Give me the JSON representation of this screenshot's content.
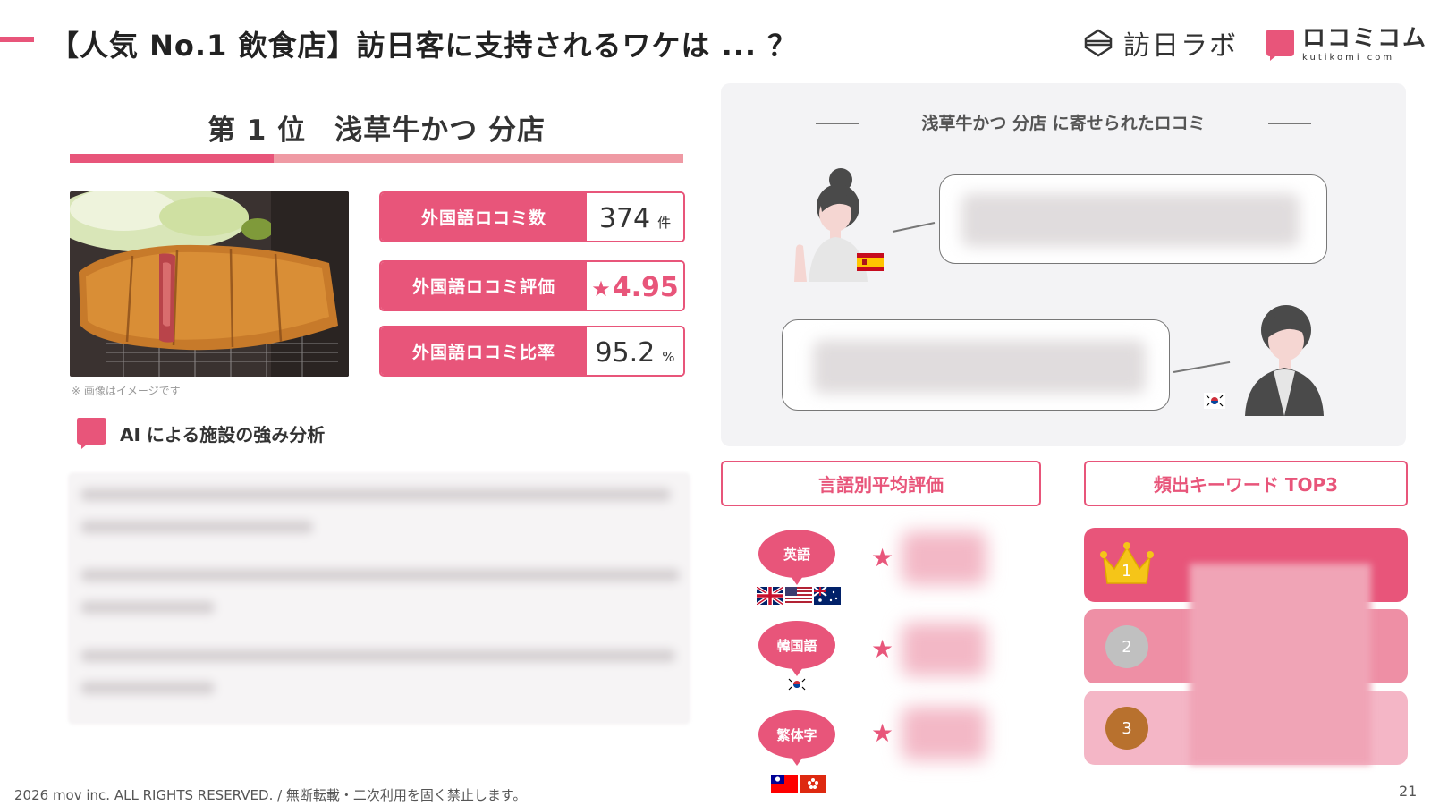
{
  "header": {
    "title": "【人気 No.1 飲食店】訪日客に支持されるワケは ... ？",
    "logo_houjin": "訪日ラボ",
    "logo_kuchikomi_main": "ロコミコム",
    "logo_kuchikomi_sub": "kutikomi com"
  },
  "ranking": {
    "title": "第 1 位　浅草牛かつ 分店",
    "photo_note": "※ 画像はイメージです"
  },
  "stats": [
    {
      "label": "外国語ロコミ数",
      "value": "374",
      "unit": "件"
    },
    {
      "label": "外国語ロコミ評価",
      "value": "4.95",
      "star": "★"
    },
    {
      "label": "外国語ロコミ比率",
      "value": "95.2",
      "unit": "%"
    }
  ],
  "ai_analysis": {
    "heading": "AI による施設の強み分析"
  },
  "reviews": {
    "title": "浅草牛かつ 分店 に寄せられたロコミ"
  },
  "language_ratings": {
    "heading": "言語別平均評価",
    "items": [
      {
        "label": "英語",
        "star": "★"
      },
      {
        "label": "韓国語",
        "star": "★"
      },
      {
        "label": "繁体字",
        "star": "★"
      }
    ]
  },
  "keywords": {
    "heading": "頻出キーワード TOP3",
    "ranks": [
      "1",
      "2",
      "3"
    ],
    "colors": [
      "#e8557a",
      "#ee8fa5",
      "#f4b6c6"
    ]
  },
  "footer": {
    "copyright": "2026 mov inc. ALL RIGHTS RESERVED. /  無断転載・二次利用を固く禁止します。",
    "page_number": "21"
  },
  "colors": {
    "accent": "#e8557a",
    "accent_light": "#ef9aa4",
    "panel_bg": "#f3f3f5"
  }
}
